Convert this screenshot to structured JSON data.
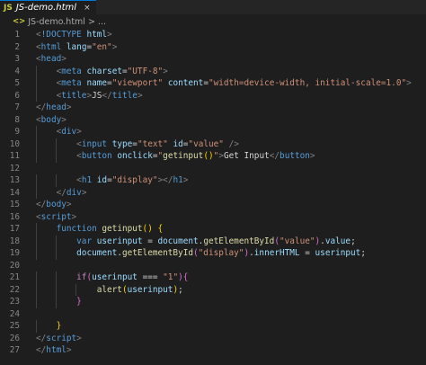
{
  "tab": {
    "icon": "JS",
    "title": "JS-demo.html",
    "close_icon": "×"
  },
  "breadcrumb": {
    "icon": "<>",
    "file": "JS-demo.html",
    "separator": ">",
    "rest": "..."
  },
  "colors": {
    "background": "#1e1e1e",
    "tag": "#569cd6",
    "attribute": "#9cdcfe",
    "string": "#ce9178",
    "function": "#dcdcaa",
    "keyword": "#c586c0"
  },
  "lines": [
    {
      "n": "1",
      "tokens": [
        [
          "br",
          "<"
        ],
        [
          "t",
          "!DOCTYPE"
        ],
        [
          "p",
          " "
        ],
        [
          "a",
          "html"
        ],
        [
          "br",
          ">"
        ]
      ]
    },
    {
      "n": "2",
      "tokens": [
        [
          "br",
          "<"
        ],
        [
          "t",
          "html"
        ],
        [
          "p",
          " "
        ],
        [
          "a",
          "lang"
        ],
        [
          "p",
          "="
        ],
        [
          "s",
          "\"en\""
        ],
        [
          "br",
          ">"
        ]
      ]
    },
    {
      "n": "3",
      "tokens": [
        [
          "br",
          "<"
        ],
        [
          "t",
          "head"
        ],
        [
          "br",
          ">"
        ]
      ]
    },
    {
      "n": "4",
      "tokens": [
        [
          "p",
          "    "
        ],
        [
          "br",
          "<"
        ],
        [
          "t",
          "meta"
        ],
        [
          "p",
          " "
        ],
        [
          "a",
          "charset"
        ],
        [
          "p",
          "="
        ],
        [
          "s",
          "\"UTF-8\""
        ],
        [
          "br",
          ">"
        ]
      ]
    },
    {
      "n": "5",
      "tokens": [
        [
          "p",
          "    "
        ],
        [
          "br",
          "<"
        ],
        [
          "t",
          "meta"
        ],
        [
          "p",
          " "
        ],
        [
          "a",
          "name"
        ],
        [
          "p",
          "="
        ],
        [
          "s",
          "\"viewport\""
        ],
        [
          "p",
          " "
        ],
        [
          "a",
          "content"
        ],
        [
          "p",
          "="
        ],
        [
          "s",
          "\"width=device-width, initial-scale=1.0\""
        ],
        [
          "br",
          ">"
        ]
      ]
    },
    {
      "n": "6",
      "tokens": [
        [
          "p",
          "    "
        ],
        [
          "br",
          "<"
        ],
        [
          "t",
          "title"
        ],
        [
          "br",
          ">"
        ],
        [
          "p",
          "JS"
        ],
        [
          "br",
          "</"
        ],
        [
          "t",
          "title"
        ],
        [
          "br",
          ">"
        ]
      ]
    },
    {
      "n": "7",
      "tokens": [
        [
          "br",
          "</"
        ],
        [
          "t",
          "head"
        ],
        [
          "br",
          ">"
        ]
      ]
    },
    {
      "n": "8",
      "tokens": [
        [
          "br",
          "<"
        ],
        [
          "t",
          "body"
        ],
        [
          "br",
          ">"
        ]
      ]
    },
    {
      "n": "9",
      "tokens": [
        [
          "p",
          "    "
        ],
        [
          "br",
          "<"
        ],
        [
          "t",
          "div"
        ],
        [
          "br",
          ">"
        ]
      ]
    },
    {
      "n": "10",
      "tokens": [
        [
          "p",
          "        "
        ],
        [
          "br",
          "<"
        ],
        [
          "t",
          "input"
        ],
        [
          "p",
          " "
        ],
        [
          "a",
          "type"
        ],
        [
          "p",
          "="
        ],
        [
          "s",
          "\"text\""
        ],
        [
          "p",
          " "
        ],
        [
          "a",
          "id"
        ],
        [
          "p",
          "="
        ],
        [
          "s",
          "\"value\""
        ],
        [
          "p",
          " "
        ],
        [
          "br",
          "/>"
        ]
      ]
    },
    {
      "n": "11",
      "tokens": [
        [
          "p",
          "        "
        ],
        [
          "br",
          "<"
        ],
        [
          "t",
          "button"
        ],
        [
          "p",
          " "
        ],
        [
          "a",
          "onclick"
        ],
        [
          "p",
          "="
        ],
        [
          "s",
          "\""
        ],
        [
          "f",
          "getinput"
        ],
        [
          "y",
          "()"
        ],
        [
          "s",
          "\""
        ],
        [
          "br",
          ">"
        ],
        [
          "p",
          "Get Input"
        ],
        [
          "br",
          "</"
        ],
        [
          "t",
          "button"
        ],
        [
          "br",
          ">"
        ]
      ]
    },
    {
      "n": "12",
      "tokens": []
    },
    {
      "n": "13",
      "tokens": [
        [
          "p",
          "        "
        ],
        [
          "br",
          "<"
        ],
        [
          "t",
          "h1"
        ],
        [
          "p",
          " "
        ],
        [
          "a",
          "id"
        ],
        [
          "p",
          "="
        ],
        [
          "s",
          "\"display\""
        ],
        [
          "br",
          "></"
        ],
        [
          "t",
          "h1"
        ],
        [
          "br",
          ">"
        ]
      ]
    },
    {
      "n": "14",
      "tokens": [
        [
          "p",
          "    "
        ],
        [
          "br",
          "</"
        ],
        [
          "t",
          "div"
        ],
        [
          "br",
          ">"
        ]
      ]
    },
    {
      "n": "15",
      "tokens": [
        [
          "br",
          "</"
        ],
        [
          "t",
          "body"
        ],
        [
          "br",
          ">"
        ]
      ]
    },
    {
      "n": "16",
      "tokens": [
        [
          "br",
          "<"
        ],
        [
          "t",
          "script"
        ],
        [
          "br",
          ">"
        ]
      ]
    },
    {
      "n": "17",
      "tokens": [
        [
          "p",
          "    "
        ],
        [
          "t",
          "function"
        ],
        [
          "p",
          " "
        ],
        [
          "f",
          "getinput"
        ],
        [
          "y",
          "()"
        ],
        [
          "p",
          " "
        ],
        [
          "y",
          "{"
        ]
      ]
    },
    {
      "n": "18",
      "tokens": [
        [
          "p",
          "        "
        ],
        [
          "t",
          "var"
        ],
        [
          "p",
          " "
        ],
        [
          "a",
          "userinput"
        ],
        [
          "p",
          " = "
        ],
        [
          "a",
          "document"
        ],
        [
          "p",
          "."
        ],
        [
          "f",
          "getElementById"
        ],
        [
          "m",
          "("
        ],
        [
          "s",
          "\"value\""
        ],
        [
          "m",
          ")"
        ],
        [
          "p",
          "."
        ],
        [
          "a",
          "value"
        ],
        [
          "p",
          ";"
        ]
      ]
    },
    {
      "n": "19",
      "tokens": [
        [
          "p",
          "        "
        ],
        [
          "a",
          "document"
        ],
        [
          "p",
          "."
        ],
        [
          "f",
          "getElementById"
        ],
        [
          "m",
          "("
        ],
        [
          "s",
          "\"display\""
        ],
        [
          "m",
          ")"
        ],
        [
          "p",
          "."
        ],
        [
          "a",
          "innerHTML"
        ],
        [
          "p",
          " = "
        ],
        [
          "a",
          "userinput"
        ],
        [
          "p",
          ";"
        ]
      ]
    },
    {
      "n": "20",
      "tokens": []
    },
    {
      "n": "21",
      "tokens": [
        [
          "p",
          "        "
        ],
        [
          "k",
          "if"
        ],
        [
          "m",
          "("
        ],
        [
          "a",
          "userinput"
        ],
        [
          "p",
          " === "
        ],
        [
          "s",
          "\"1\""
        ],
        [
          "m",
          ")"
        ],
        [
          "m",
          "{"
        ]
      ]
    },
    {
      "n": "22",
      "tokens": [
        [
          "p",
          "            "
        ],
        [
          "f",
          "alert"
        ],
        [
          "y",
          "("
        ],
        [
          "a",
          "userinput"
        ],
        [
          "y",
          ")"
        ],
        [
          "p",
          ";"
        ]
      ]
    },
    {
      "n": "23",
      "tokens": [
        [
          "p",
          "        "
        ],
        [
          "m",
          "}"
        ]
      ]
    },
    {
      "n": "24",
      "tokens": []
    },
    {
      "n": "25",
      "tokens": [
        [
          "p",
          "    "
        ],
        [
          "y",
          "}"
        ]
      ]
    },
    {
      "n": "26",
      "tokens": [
        [
          "br",
          "</"
        ],
        [
          "t",
          "script"
        ],
        [
          "br",
          ">"
        ]
      ]
    },
    {
      "n": "27",
      "tokens": [
        [
          "br",
          "</"
        ],
        [
          "t",
          "html"
        ],
        [
          "br",
          ">"
        ]
      ]
    }
  ]
}
